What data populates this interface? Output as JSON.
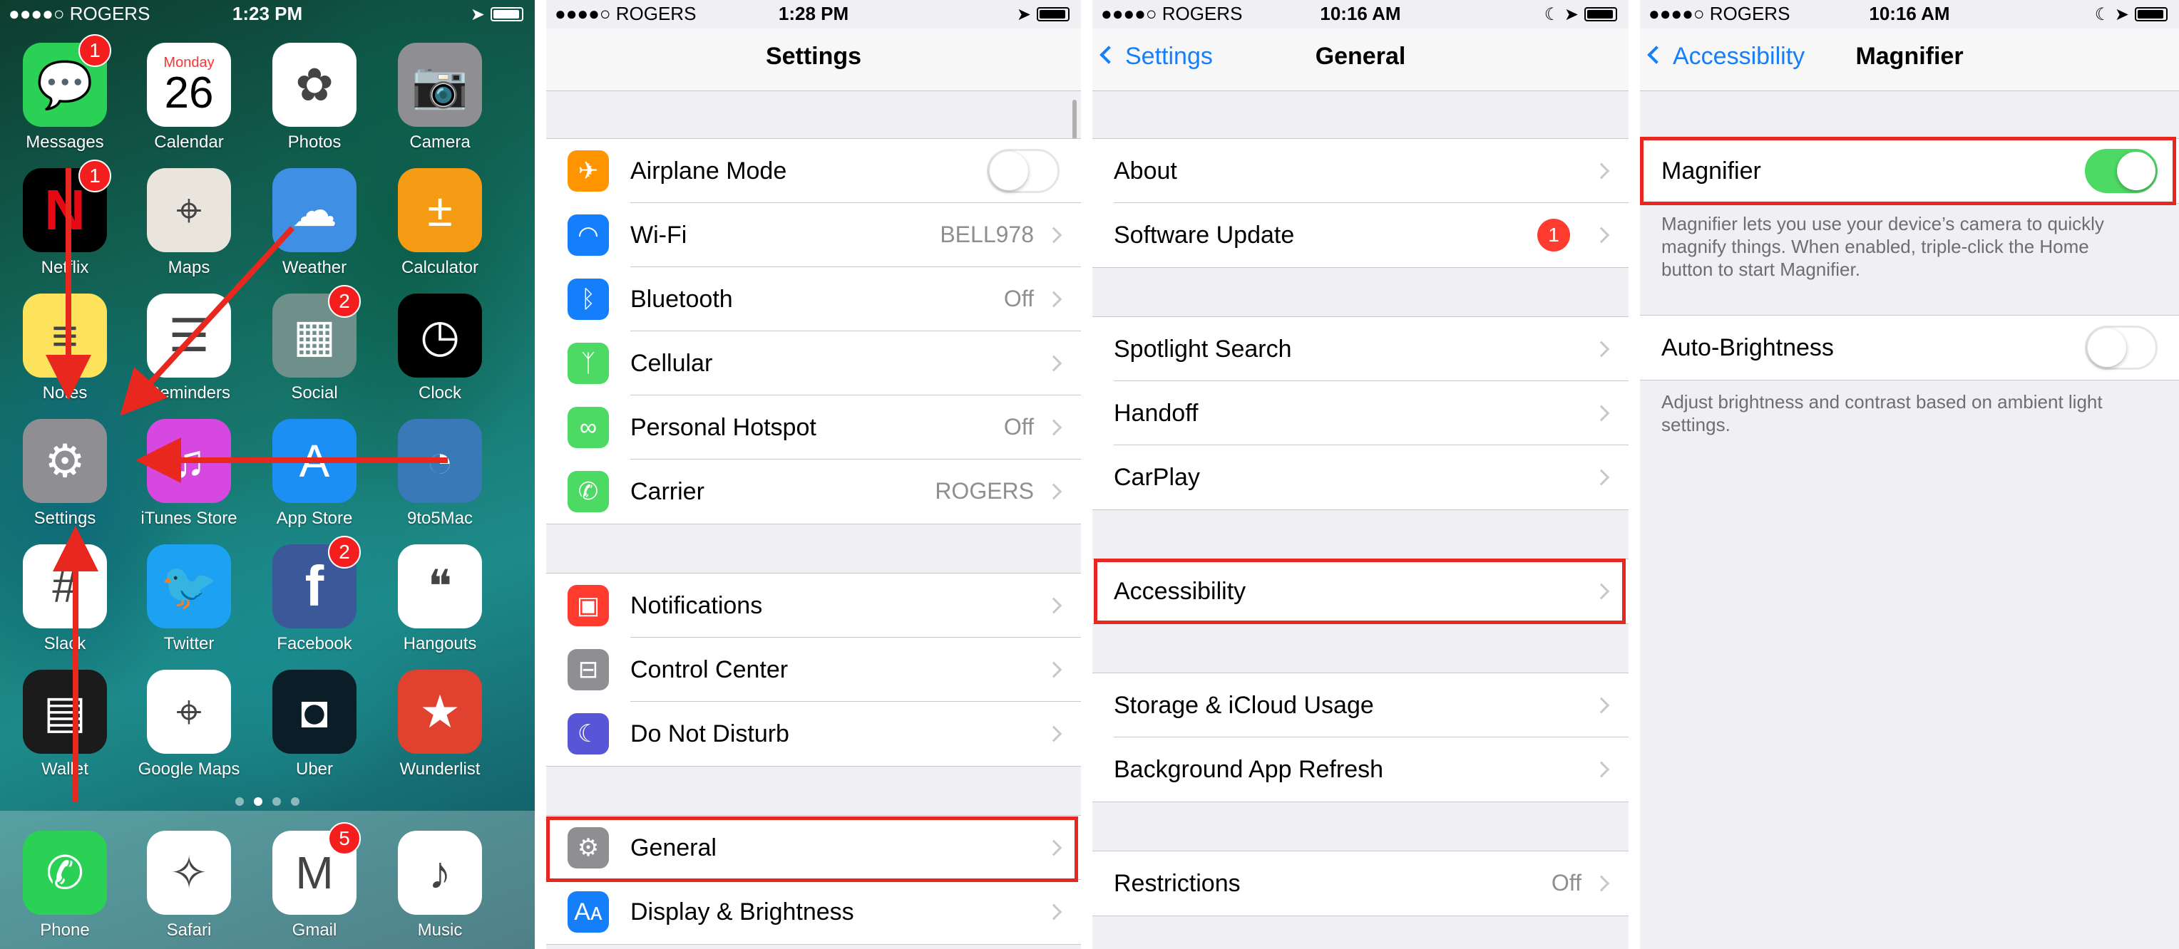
{
  "home": {
    "status": {
      "carrier": "●●●●○ ROGERS",
      "time": "1:23 PM"
    },
    "apps": [
      {
        "label": "Messages",
        "badge": "1",
        "icon": "messages-icon",
        "color": "#2bd155"
      },
      {
        "label": "Calendar",
        "icon": "calendar-icon",
        "color": "#ffffff",
        "day": "Monday",
        "date": "26"
      },
      {
        "label": "Photos",
        "icon": "photos-icon",
        "color": "#ffffff"
      },
      {
        "label": "Camera",
        "icon": "camera-icon",
        "color": "#8e8e93"
      },
      {
        "label": "Netflix",
        "badge": "1",
        "icon": "netflix-icon",
        "color": "#000000",
        "glyph": "N"
      },
      {
        "label": "Maps",
        "icon": "maps-icon",
        "color": "#e9e5dc"
      },
      {
        "label": "Weather",
        "icon": "weather-icon",
        "color": "#3f8fe5"
      },
      {
        "label": "Calculator",
        "icon": "calculator-icon",
        "color": "#f59b14"
      },
      {
        "label": "Notes",
        "icon": "notes-icon",
        "color": "#fde35c"
      },
      {
        "label": "Reminders",
        "icon": "reminders-icon",
        "color": "#ffffff"
      },
      {
        "label": "Social",
        "badge": "2",
        "icon": "social-folder-icon",
        "color": "#6f8f8a"
      },
      {
        "label": "Clock",
        "icon": "clock-icon",
        "color": "#000000"
      },
      {
        "label": "Settings",
        "icon": "settings-gear-icon",
        "color": "#8e8e93"
      },
      {
        "label": "iTunes Store",
        "icon": "itunes-store-icon",
        "color": "#d748e0"
      },
      {
        "label": "App Store",
        "icon": "app-store-icon",
        "color": "#1c8ff5"
      },
      {
        "label": "9to5Mac",
        "icon": "9to5mac-icon",
        "color": "#3a79b8"
      },
      {
        "label": "Slack",
        "icon": "slack-icon",
        "color": "#ffffff"
      },
      {
        "label": "Twitter",
        "icon": "twitter-icon",
        "color": "#1da1f2"
      },
      {
        "label": "Facebook",
        "badge": "2",
        "icon": "facebook-icon",
        "color": "#3b5998",
        "glyph": "f"
      },
      {
        "label": "Hangouts",
        "icon": "hangouts-icon",
        "color": "#ffffff"
      },
      {
        "label": "Wallet",
        "icon": "wallet-icon",
        "color": "#1b1b1b"
      },
      {
        "label": "Google Maps",
        "icon": "google-maps-icon",
        "color": "#ffffff"
      },
      {
        "label": "Uber",
        "icon": "uber-icon",
        "color": "#0b1d26"
      },
      {
        "label": "Wunderlist",
        "icon": "wunderlist-icon",
        "color": "#e1412f"
      }
    ],
    "dock": [
      {
        "label": "Phone",
        "icon": "phone-icon",
        "color": "#2bd155"
      },
      {
        "label": "Safari",
        "icon": "safari-icon",
        "color": "#ffffff"
      },
      {
        "label": "Gmail",
        "badge": "5",
        "icon": "gmail-icon",
        "color": "#ffffff"
      },
      {
        "label": "Music",
        "icon": "music-icon",
        "color": "#ffffff"
      }
    ]
  },
  "settings": {
    "status": {
      "carrier": "●●●●○ ROGERS",
      "time": "1:28 PM"
    },
    "title": "Settings",
    "group1": [
      {
        "label": "Airplane Mode",
        "icon": "airplane-icon",
        "color": "#ff9500",
        "toggle": "off"
      },
      {
        "label": "Wi-Fi",
        "value": "BELL978",
        "icon": "wifi-icon",
        "color": "#157efb"
      },
      {
        "label": "Bluetooth",
        "value": "Off",
        "icon": "bluetooth-icon",
        "color": "#157efb"
      },
      {
        "label": "Cellular",
        "icon": "cellular-icon",
        "color": "#4cd964"
      },
      {
        "label": "Personal Hotspot",
        "value": "Off",
        "icon": "hotspot-icon",
        "color": "#4cd964"
      },
      {
        "label": "Carrier",
        "value": "ROGERS",
        "icon": "phone-icon",
        "color": "#4cd964"
      }
    ],
    "group2": [
      {
        "label": "Notifications",
        "icon": "notifications-icon",
        "color": "#ff3b30"
      },
      {
        "label": "Control Center",
        "icon": "control-center-icon",
        "color": "#8e8e93"
      },
      {
        "label": "Do Not Disturb",
        "icon": "moon-icon",
        "color": "#5856d6"
      }
    ],
    "group3": [
      {
        "label": "General",
        "icon": "gear-icon",
        "color": "#8e8e93"
      },
      {
        "label": "Display & Brightness",
        "icon": "display-icon",
        "color": "#157efb"
      }
    ]
  },
  "general": {
    "status": {
      "carrier": "●●●●○ ROGERS",
      "time": "10:16 AM"
    },
    "back": "Settings",
    "title": "General",
    "group1": [
      {
        "label": "About"
      },
      {
        "label": "Software Update",
        "badge": "1"
      }
    ],
    "group2": [
      {
        "label": "Spotlight Search"
      },
      {
        "label": "Handoff"
      },
      {
        "label": "CarPlay"
      }
    ],
    "group3": [
      {
        "label": "Accessibility"
      }
    ],
    "group4": [
      {
        "label": "Storage & iCloud Usage"
      },
      {
        "label": "Background App Refresh"
      }
    ],
    "group5": [
      {
        "label": "Restrictions",
        "value": "Off"
      }
    ]
  },
  "magnifier": {
    "status": {
      "carrier": "●●●●○ ROGERS",
      "time": "10:16 AM"
    },
    "back": "Accessibility",
    "title": "Magnifier",
    "magnifier_label": "Magnifier",
    "magnifier_toggle": "on",
    "magnifier_footer": "Magnifier lets you use your device’s camera to quickly magnify things. When enabled, triple-click the Home button to start Magnifier.",
    "auto_label": "Auto-Brightness",
    "auto_toggle": "off",
    "auto_footer": "Adjust brightness and contrast based on ambient light settings."
  },
  "highlight_color": "#e8281f",
  "arrow_color": "#e8281f"
}
